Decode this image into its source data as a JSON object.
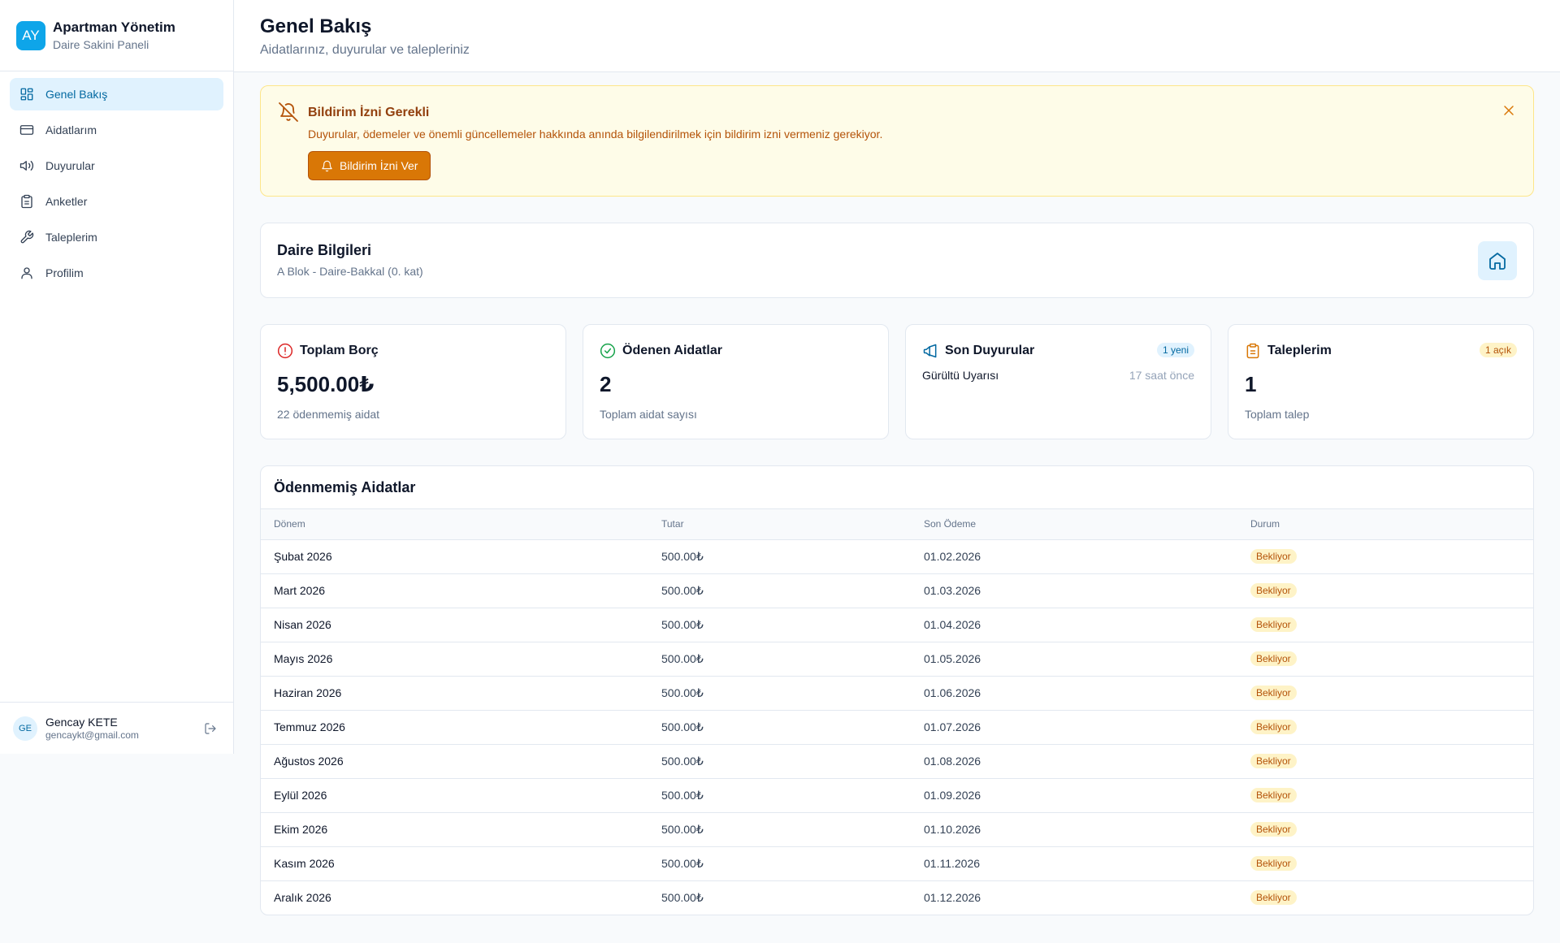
{
  "brand": {
    "initials": "AY",
    "title": "Apartman Yönetim",
    "subtitle": "Daire Sakini Paneli"
  },
  "nav": [
    {
      "label": "Genel Bakış",
      "icon": "dashboard-icon",
      "active": true
    },
    {
      "label": "Aidatlarım",
      "icon": "credit-card-icon"
    },
    {
      "label": "Duyurular",
      "icon": "megaphone-icon"
    },
    {
      "label": "Anketler",
      "icon": "clipboard-icon"
    },
    {
      "label": "Taleplerim",
      "icon": "wrench-icon"
    },
    {
      "label": "Profilim",
      "icon": "user-icon"
    }
  ],
  "user": {
    "initials": "GE",
    "name": "Gencay KETE",
    "email": "gencaykt@gmail.com"
  },
  "header": {
    "title": "Genel Bakış",
    "subtitle": "Aidatlarınız, duyurular ve talepleriniz"
  },
  "alert": {
    "title": "Bildirim İzni Gerekli",
    "text": "Duyurular, ödemeler ve önemli güncellemeler hakkında anında bilgilendirilmek için bildirim izni vermeniz gerekiyor.",
    "button": "Bildirim İzni Ver"
  },
  "apartment": {
    "title": "Daire Bilgileri",
    "detail": "A Blok - Daire-Bakkal (0. kat)"
  },
  "stats": {
    "debt": {
      "label": "Toplam Borç",
      "value": "5,500.00₺",
      "note": "22 ödenmemiş aidat"
    },
    "paid": {
      "label": "Ödenen Aidatlar",
      "value": "2",
      "note": "Toplam aidat sayısı"
    },
    "announcements": {
      "label": "Son Duyurular",
      "badge": "1 yeni",
      "item_title": "Gürültü Uyarısı",
      "item_time": "17 saat önce"
    },
    "requests": {
      "label": "Taleplerim",
      "badge": "1 açık",
      "value": "1",
      "note": "Toplam talep"
    }
  },
  "unpaid": {
    "title": "Ödenmemiş Aidatlar",
    "columns": [
      "Dönem",
      "Tutar",
      "Son Ödeme",
      "Durum"
    ],
    "rows": [
      {
        "period": "Şubat 2026",
        "amount": "500.00₺",
        "due": "01.02.2026",
        "status": "Bekliyor"
      },
      {
        "period": "Mart 2026",
        "amount": "500.00₺",
        "due": "01.03.2026",
        "status": "Bekliyor"
      },
      {
        "period": "Nisan 2026",
        "amount": "500.00₺",
        "due": "01.04.2026",
        "status": "Bekliyor"
      },
      {
        "period": "Mayıs 2026",
        "amount": "500.00₺",
        "due": "01.05.2026",
        "status": "Bekliyor"
      },
      {
        "period": "Haziran 2026",
        "amount": "500.00₺",
        "due": "01.06.2026",
        "status": "Bekliyor"
      },
      {
        "period": "Temmuz 2026",
        "amount": "500.00₺",
        "due": "01.07.2026",
        "status": "Bekliyor"
      },
      {
        "period": "Ağustos 2026",
        "amount": "500.00₺",
        "due": "01.08.2026",
        "status": "Bekliyor"
      },
      {
        "period": "Eylül 2026",
        "amount": "500.00₺",
        "due": "01.09.2026",
        "status": "Bekliyor"
      },
      {
        "period": "Ekim 2026",
        "amount": "500.00₺",
        "due": "01.10.2026",
        "status": "Bekliyor"
      },
      {
        "period": "Kasım 2026",
        "amount": "500.00₺",
        "due": "01.11.2026",
        "status": "Bekliyor"
      },
      {
        "period": "Aralık 2026",
        "amount": "500.00₺",
        "due": "01.12.2026",
        "status": "Bekliyor"
      }
    ]
  },
  "colors": {
    "accent": "#0ea5e9",
    "warning": "#d97706",
    "danger": "#dc2626",
    "success": "#16a34a"
  }
}
